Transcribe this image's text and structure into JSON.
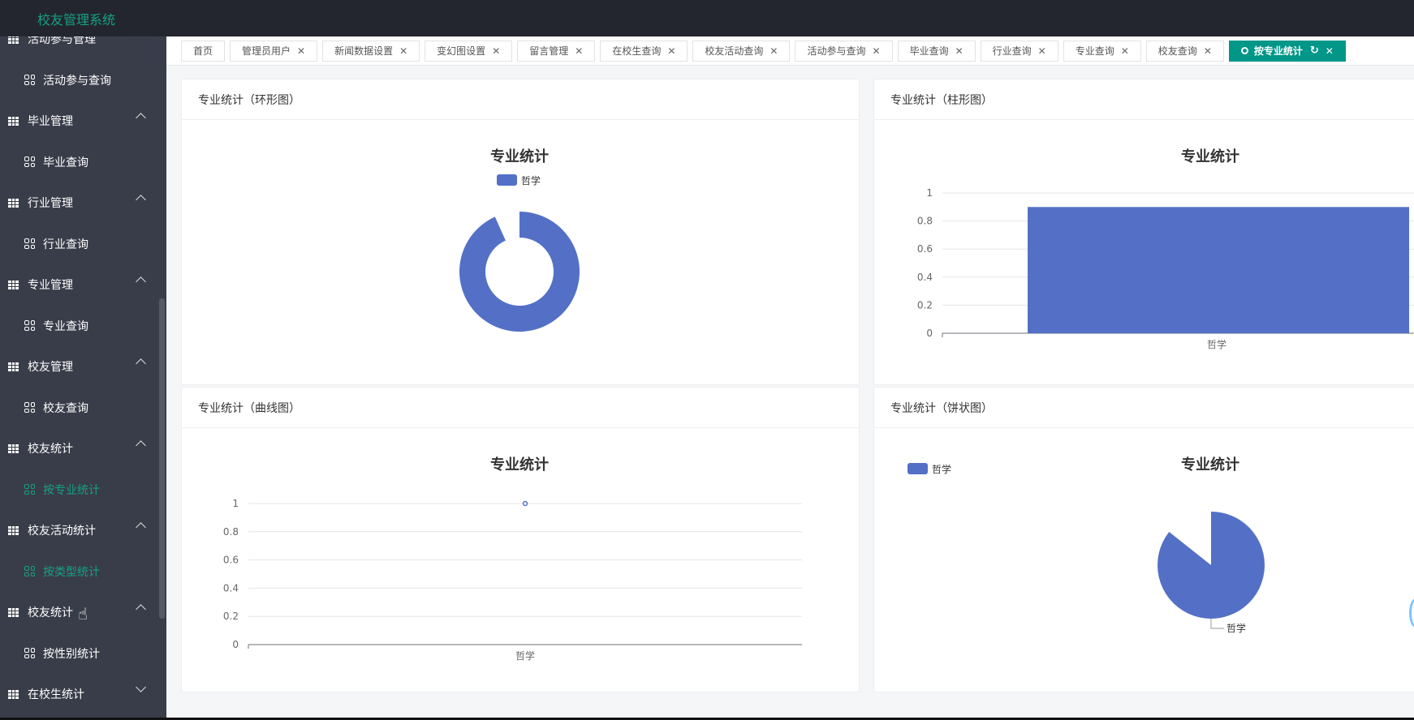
{
  "app": {
    "title": "校友管理系统"
  },
  "sidebar": {
    "groups": [
      {
        "label": "活动参与管理",
        "sub": "活动参与查询",
        "expanded": true,
        "active": false
      },
      {
        "label": "毕业管理",
        "sub": "毕业查询",
        "expanded": true,
        "active": false
      },
      {
        "label": "行业管理",
        "sub": "行业查询",
        "expanded": true,
        "active": false
      },
      {
        "label": "专业管理",
        "sub": "专业查询",
        "expanded": true,
        "active": false
      },
      {
        "label": "校友管理",
        "sub": "校友查询",
        "expanded": true,
        "active": false
      },
      {
        "label": "校友统计",
        "sub": "按专业统计",
        "expanded": true,
        "active": true
      },
      {
        "label": "校友活动统计",
        "sub": "按类型统计",
        "expanded": true,
        "active": true
      },
      {
        "label": "校友统计",
        "sub": "按性别统计",
        "expanded": true,
        "active": false
      },
      {
        "label": "在校生统计",
        "sub": "",
        "expanded": false,
        "active": false
      }
    ]
  },
  "tabs": [
    {
      "label": "首页",
      "closable": false
    },
    {
      "label": "管理员用户",
      "closable": true
    },
    {
      "label": "新闻数据设置",
      "closable": true
    },
    {
      "label": "变幻图设置",
      "closable": true
    },
    {
      "label": "留言管理",
      "closable": true
    },
    {
      "label": "在校生查询",
      "closable": true
    },
    {
      "label": "校友活动查询",
      "closable": true
    },
    {
      "label": "活动参与查询",
      "closable": true
    },
    {
      "label": "毕业查询",
      "closable": true
    },
    {
      "label": "行业查询",
      "closable": true
    },
    {
      "label": "专业查询",
      "closable": true
    },
    {
      "label": "校友查询",
      "closable": true
    },
    {
      "label": "按专业统计",
      "closable": true,
      "active": true
    }
  ],
  "panels": {
    "donut": {
      "heading": "专业统计（环形图）"
    },
    "bar": {
      "heading": "专业统计（柱形图）"
    },
    "line": {
      "heading": "专业统计（曲线图）"
    },
    "pie": {
      "heading": "专业统计（饼状图）"
    }
  },
  "colors": {
    "series": "#5470c6",
    "accent": "#009688",
    "topbar": "#23262e",
    "sidebar": "#393d49"
  },
  "chart_data": [
    {
      "type": "pie",
      "variant": "donut",
      "title": "专业统计",
      "legend": [
        "哲学"
      ],
      "legend_position": "top-center",
      "categories": [
        "哲学"
      ],
      "values": [
        1
      ]
    },
    {
      "type": "bar",
      "title": "专业统计",
      "categories": [
        "哲学"
      ],
      "values": [
        0.9
      ],
      "ylim": [
        0,
        1
      ],
      "yticks": [
        "0",
        "0.2",
        "0.4",
        "0.6",
        "0.8",
        "1"
      ],
      "grid": true
    },
    {
      "type": "line",
      "title": "专业统计",
      "categories": [
        "哲学"
      ],
      "values": [
        1
      ],
      "ylim": [
        0,
        1
      ],
      "yticks": [
        "0",
        "0.2",
        "0.4",
        "0.6",
        "0.8",
        "1"
      ],
      "grid": true
    },
    {
      "type": "pie",
      "title": "专业统计",
      "legend": [
        "哲学"
      ],
      "legend_position": "top-left",
      "categories": [
        "哲学"
      ],
      "values": [
        1
      ],
      "slice_label": "哲学"
    }
  ]
}
